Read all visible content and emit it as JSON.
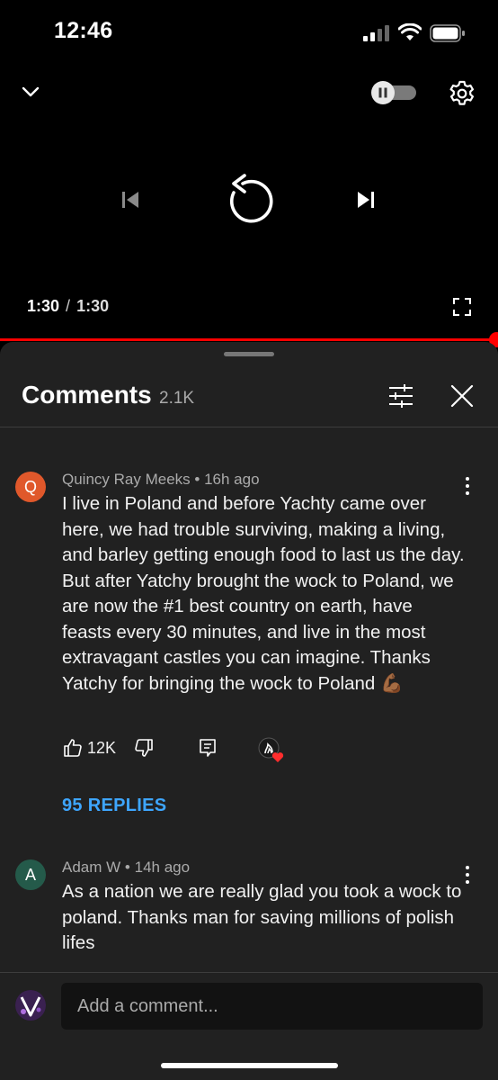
{
  "status_bar": {
    "time": "12:46"
  },
  "player": {
    "current_time": "1:30",
    "separator": "/",
    "duration": "1:30",
    "progress": 1.0,
    "accent_color": "#ff0000"
  },
  "comments_panel": {
    "title": "Comments",
    "count": "2.1K",
    "comments": [
      {
        "avatar_letter": "Q",
        "avatar_color": "#e0582b",
        "author": "Quincy Ray Meeks",
        "time": "16h ago",
        "text": "I live in Poland and before Yachty came over here, we had trouble surviving, making a living, and barley getting enough food to last us the day. But after Yatchy brought the wock to Poland, we are now the #1 best country on earth, have feasts every 30 minutes, and live in the most extravagant castles you can imagine. Thanks Yatchy for bringing the wock to Poland 💪🏾",
        "likes": "12K",
        "replies": "95 REPLIES"
      },
      {
        "avatar_letter": "A",
        "avatar_color": "#245a4a",
        "author": "Adam W",
        "time": "14h ago",
        "text": "As a nation we are really glad you took a wock to poland. Thanks man for saving millions of polish lifes"
      }
    ],
    "composer": {
      "placeholder": "Add a comment..."
    }
  },
  "colors": {
    "link": "#3ea6ff",
    "sheet_bg": "#212121",
    "heart": "#ff2d2d"
  }
}
